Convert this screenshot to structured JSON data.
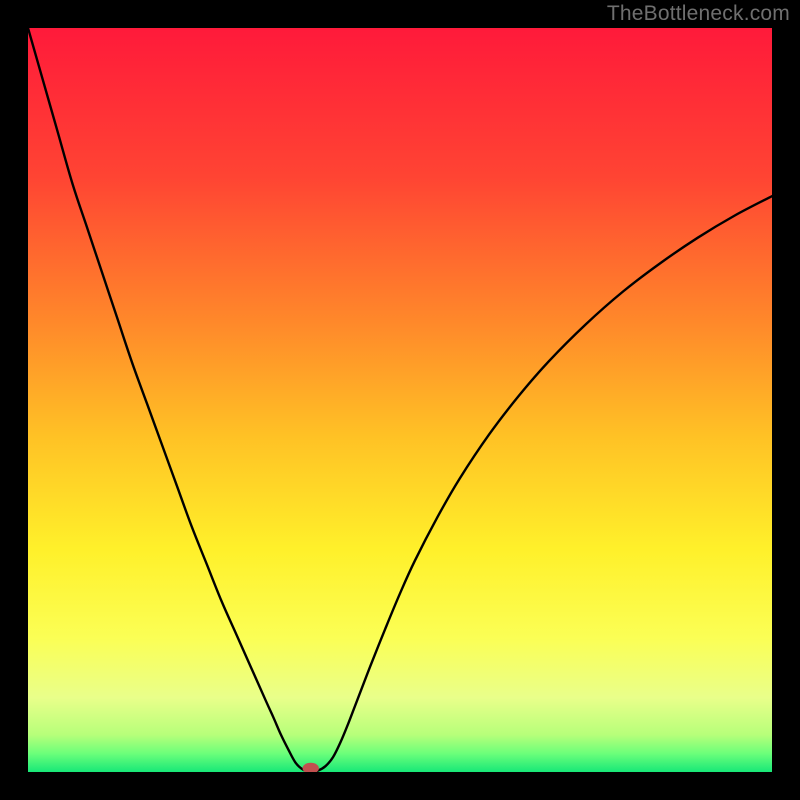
{
  "watermark": "TheBottleneck.com",
  "chart_data": {
    "type": "line",
    "title": "",
    "xlabel": "",
    "ylabel": "",
    "xlim": [
      0,
      100
    ],
    "ylim": [
      0,
      100
    ],
    "background_gradient": {
      "stops": [
        {
          "offset": 0.0,
          "color": "#ff1a3a"
        },
        {
          "offset": 0.2,
          "color": "#ff4433"
        },
        {
          "offset": 0.4,
          "color": "#ff8a2a"
        },
        {
          "offset": 0.55,
          "color": "#ffc225"
        },
        {
          "offset": 0.7,
          "color": "#fff02a"
        },
        {
          "offset": 0.82,
          "color": "#fbff55"
        },
        {
          "offset": 0.9,
          "color": "#e9ff8a"
        },
        {
          "offset": 0.95,
          "color": "#b7ff7a"
        },
        {
          "offset": 0.975,
          "color": "#6cff7a"
        },
        {
          "offset": 1.0,
          "color": "#18e878"
        }
      ]
    },
    "series": [
      {
        "name": "bottleneck-curve",
        "color": "#000000",
        "x": [
          0,
          2,
          4,
          6,
          8,
          10,
          12,
          14,
          16,
          18,
          20,
          22,
          24,
          26,
          28,
          30,
          32,
          33,
          34,
          35,
          36,
          37,
          38,
          39,
          40,
          41,
          42,
          43,
          44,
          46,
          48,
          50,
          52,
          55,
          58,
          62,
          66,
          70,
          75,
          80,
          85,
          90,
          95,
          100
        ],
        "values": [
          100,
          93,
          86,
          79,
          73,
          67,
          61,
          55,
          49.5,
          44,
          38.5,
          33,
          28,
          23,
          18.5,
          14,
          9.5,
          7.3,
          5,
          3,
          1.2,
          0.3,
          0,
          0.2,
          0.8,
          2.0,
          4.0,
          6.4,
          9.0,
          14.2,
          19.2,
          24.0,
          28.4,
          34.2,
          39.4,
          45.4,
          50.6,
          55.2,
          60.2,
          64.6,
          68.4,
          71.8,
          74.8,
          77.4
        ]
      }
    ],
    "marker": {
      "name": "optimum-point",
      "x": 38,
      "y": 0.5,
      "rx": 1.1,
      "ry": 0.75,
      "color": "#c1504f"
    }
  }
}
